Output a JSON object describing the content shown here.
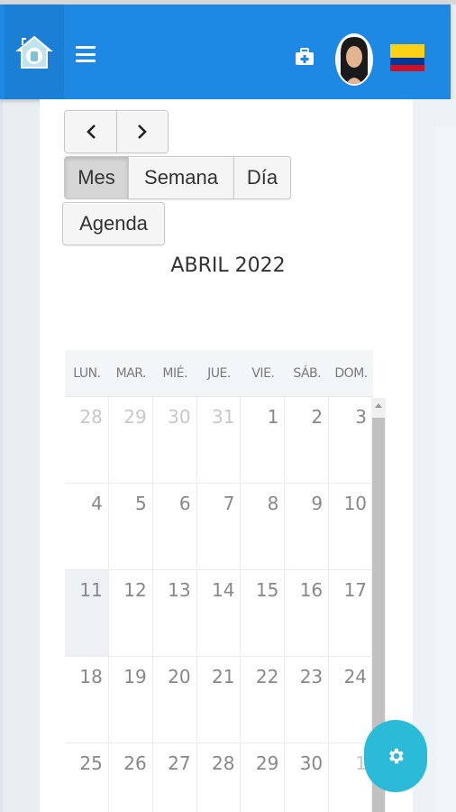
{
  "header": {
    "logo_icon": "home-heart-icon",
    "menu_icon": "hamburger-menu-icon",
    "medical_icon": "medical-kit-icon",
    "avatar_icon": "user-avatar",
    "flag_icon": "colombia-flag-icon",
    "colors": {
      "bar": "#1e88e5",
      "flag_yellow": "#fcd116",
      "flag_blue": "#003893",
      "flag_red": "#ce1126"
    }
  },
  "toolbar": {
    "prev_label": "<",
    "next_label": ">",
    "view_month": "Mes",
    "view_week": "Semana",
    "view_day": "Día",
    "view_agenda": "Agenda"
  },
  "calendar": {
    "title": "ABRIL 2022",
    "weekdays": [
      "LUN.",
      "MAR.",
      "MIÉ.",
      "JUE.",
      "VIE.",
      "SÁB.",
      "DOM."
    ],
    "weeks": [
      [
        "28",
        "29",
        "30",
        "31",
        "1",
        "2",
        "3"
      ],
      [
        "4",
        "5",
        "6",
        "7",
        "8",
        "9",
        "10"
      ],
      [
        "11",
        "12",
        "13",
        "14",
        "15",
        "16",
        "17"
      ],
      [
        "18",
        "19",
        "20",
        "21",
        "22",
        "23",
        "24"
      ],
      [
        "25",
        "26",
        "27",
        "28",
        "29",
        "30",
        "1"
      ]
    ]
  },
  "fab": {
    "icon": "gear-icon",
    "color": "#2bbbd8"
  }
}
